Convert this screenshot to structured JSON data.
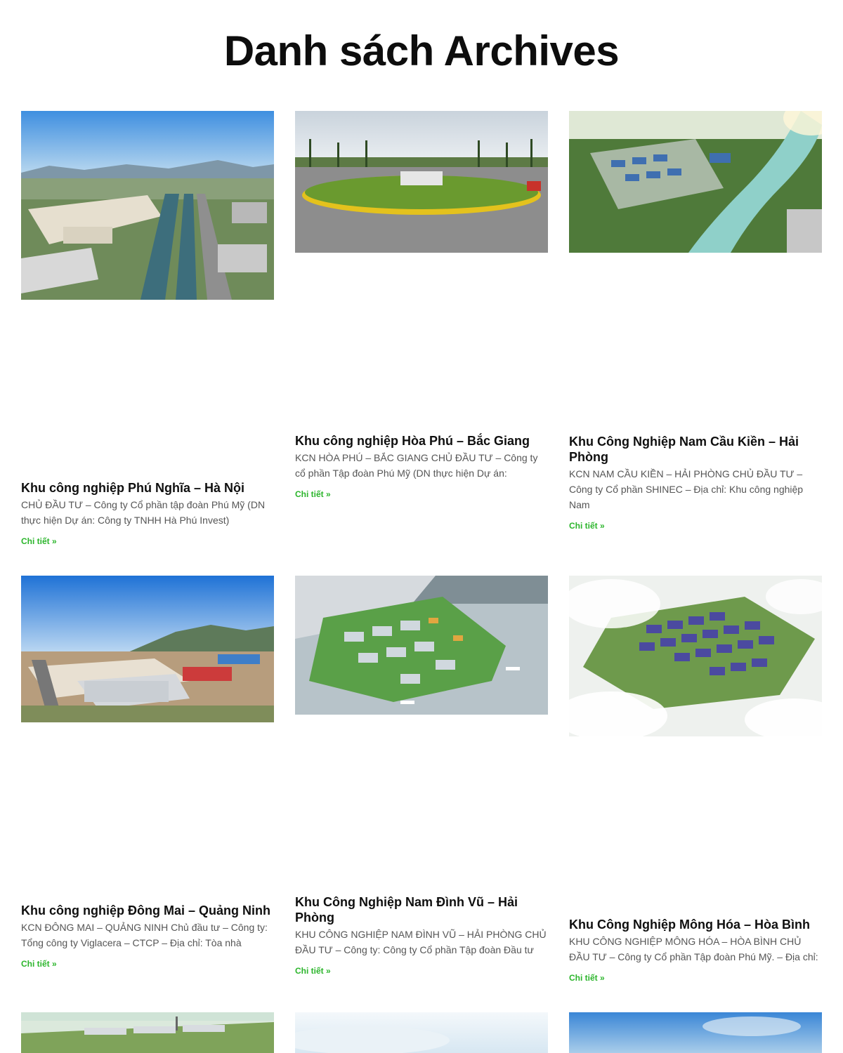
{
  "page": {
    "title": "Danh sách Archives"
  },
  "link_color": "#2bb52b",
  "posts": [
    {
      "title": "Khu công nghiệp Phú Nghĩa – Hà Nội",
      "excerpt": "CHỦ ĐẦU TƯ – Công ty Cổ phần tập đoàn Phú Mỹ (DN thực hiện Dự án: Công ty TNHH Hà Phú Invest)",
      "link": "Chi tiết »",
      "image": "aerial-industrial-park-canal"
    },
    {
      "title": "Khu công nghiệp Hòa Phú – Bắc Giang",
      "excerpt": "KCN HÒA PHÚ – BẮC GIANG CHỦ ĐẦU TƯ – Công ty cổ phần Tập đoàn Phú Mỹ (DN thực hiện Dự án:",
      "link": "Chi tiết »",
      "image": "entrance-roundabout"
    },
    {
      "title": "Khu Công Nghiệp Nam Cầu Kiền – Hải Phòng",
      "excerpt": "KCN NAM CẦU KIỀN – HẢI PHÒNG CHỦ ĐẦU TƯ – Công ty Cổ phần SHINEC – Địa chỉ: Khu công nghiệp Nam",
      "link": "Chi tiết »",
      "image": "aerial-park-river"
    },
    {
      "title": "Khu công nghiệp Đông Mai – Quảng Ninh",
      "excerpt": "KCN ĐÔNG MAI – QUẢNG NINH Chủ đầu tư – Công ty: Tổng công ty Viglacera – CTCP – Địa chỉ: Tòa nhà",
      "link": "Chi tiết »",
      "image": "factories-mountains"
    },
    {
      "title": "Khu Công Nghiệp Nam Đình Vũ – Hải Phòng",
      "excerpt": "KHU CÔNG NGHIỆP NAM ĐÌNH VŨ – HẢI PHÒNG CHỦ ĐẦU TƯ – Công ty: Công ty Cổ phần Tập đoàn Đầu tư",
      "link": "Chi tiết »",
      "image": "port-peninsula-render"
    },
    {
      "title": "Khu Công Nghiệp Mông Hóa – Hòa Bình",
      "excerpt": "KHU CÔNG NGHIỆP MÔNG HÓA – HÒA BÌNH CHỦ ĐẦU TƯ – Công ty Cổ phần Tập đoàn Phú Mỹ. – Địa chỉ:",
      "link": "Chi tiết »",
      "image": "masterplan-clouds"
    }
  ]
}
